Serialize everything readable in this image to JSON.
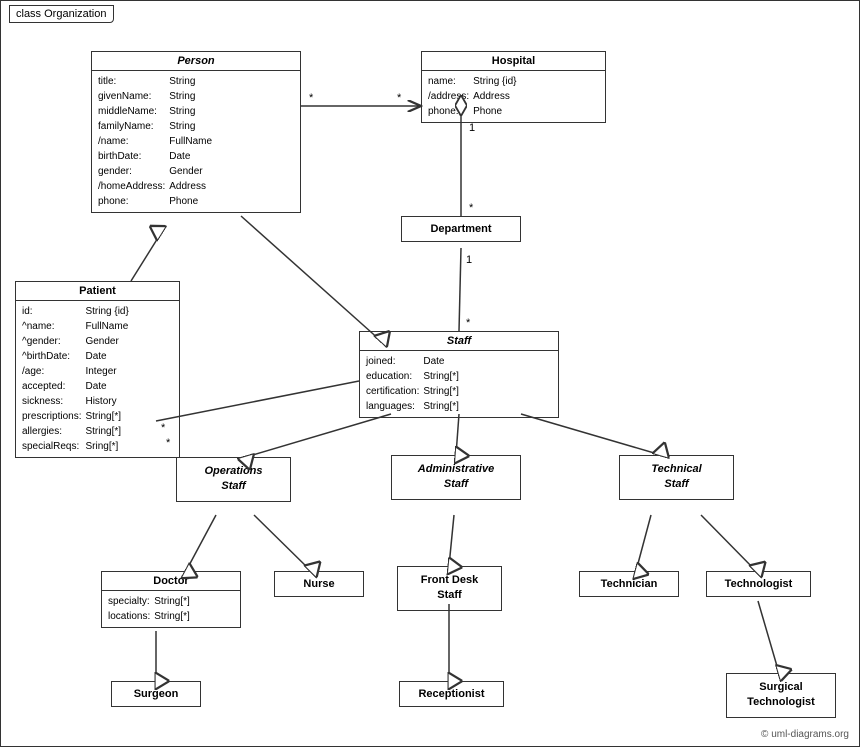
{
  "title": "class Organization",
  "classes": {
    "person": {
      "name": "Person",
      "italic": true,
      "attributes": [
        [
          "title:",
          "String"
        ],
        [
          "givenName:",
          "String"
        ],
        [
          "middleName:",
          "String"
        ],
        [
          "familyName:",
          "String"
        ],
        [
          "/name:",
          "FullName"
        ],
        [
          "birthDate:",
          "Date"
        ],
        [
          "gender:",
          "Gender"
        ],
        [
          "/homeAddress:",
          "Address"
        ],
        [
          "phone:",
          "Phone"
        ]
      ]
    },
    "hospital": {
      "name": "Hospital",
      "attributes": [
        [
          "name:",
          "String {id}"
        ],
        [
          "/address:",
          "Address"
        ],
        [
          "phone:",
          "Phone"
        ]
      ]
    },
    "patient": {
      "name": "Patient",
      "attributes": [
        [
          "id:",
          "String {id}"
        ],
        [
          "^name:",
          "FullName"
        ],
        [
          "^gender:",
          "Gender"
        ],
        [
          "^birthDate:",
          "Date"
        ],
        [
          "/age:",
          "Integer"
        ],
        [
          "accepted:",
          "Date"
        ],
        [
          "sickness:",
          "History"
        ],
        [
          "prescriptions:",
          "String[*]"
        ],
        [
          "allergies:",
          "String[*]"
        ],
        [
          "specialReqs:",
          "Sring[*]"
        ]
      ]
    },
    "department": {
      "name": "Department"
    },
    "staff": {
      "name": "Staff",
      "italic": true,
      "attributes": [
        [
          "joined:",
          "Date"
        ],
        [
          "education:",
          "String[*]"
        ],
        [
          "certification:",
          "String[*]"
        ],
        [
          "languages:",
          "String[*]"
        ]
      ]
    },
    "operations_staff": {
      "name": "Operations\nStaff",
      "italic": true
    },
    "administrative_staff": {
      "name": "Administrative\nStaff",
      "italic": true
    },
    "technical_staff": {
      "name": "Technical\nStaff",
      "italic": true
    },
    "doctor": {
      "name": "Doctor",
      "attributes": [
        [
          "specialty:",
          "String[*]"
        ],
        [
          "locations:",
          "String[*]"
        ]
      ]
    },
    "nurse": {
      "name": "Nurse"
    },
    "front_desk_staff": {
      "name": "Front Desk\nStaff"
    },
    "technician": {
      "name": "Technician"
    },
    "technologist": {
      "name": "Technologist"
    },
    "surgeon": {
      "name": "Surgeon"
    },
    "receptionist": {
      "name": "Receptionist"
    },
    "surgical_technologist": {
      "name": "Surgical\nTechnologist"
    }
  },
  "multiplicity": {
    "star": "*",
    "one": "1"
  },
  "copyright": "© uml-diagrams.org"
}
